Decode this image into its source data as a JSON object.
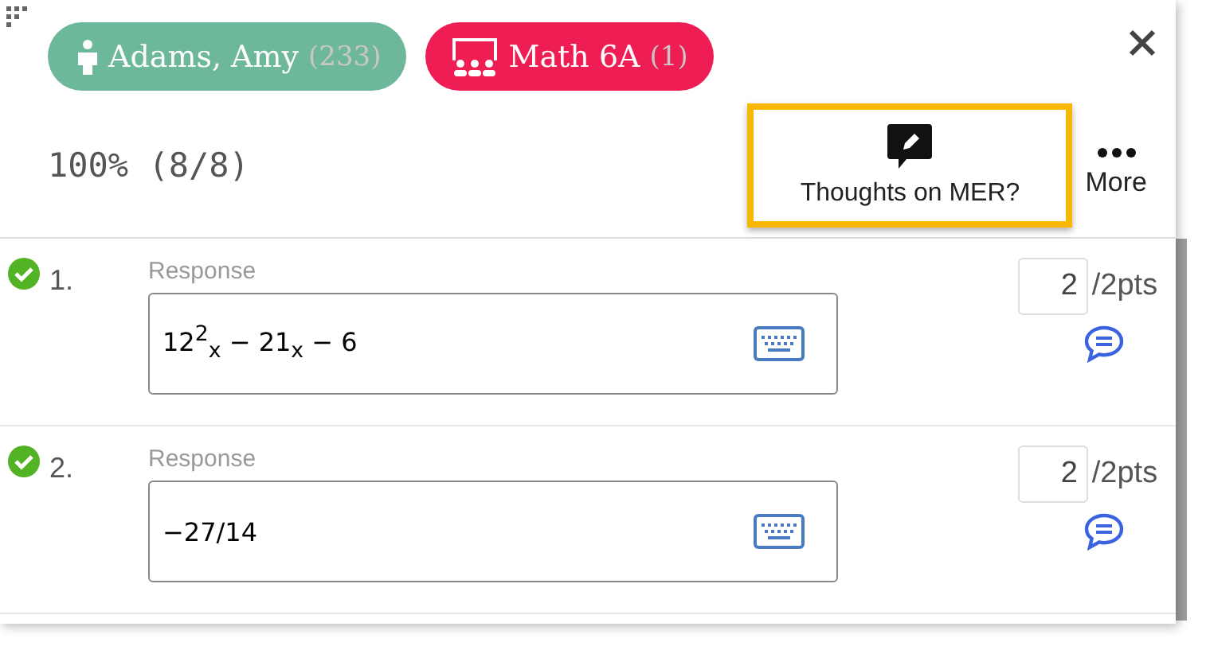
{
  "header": {
    "student": {
      "name": "Adams, Amy",
      "count": "(233)"
    },
    "class": {
      "name": "Math 6A",
      "count": "(1)"
    },
    "score": "100% (8/8)",
    "feedback_button": {
      "label": "Thoughts on MER?",
      "highlighted": true
    },
    "more_button": {
      "label": "More"
    }
  },
  "questions": [
    {
      "number": "1.",
      "correct": true,
      "label": "Response",
      "answer": "12$^{2}$$_{x}$ − 21$_{x}$ − 6",
      "points": "2",
      "max": "/2pts"
    },
    {
      "number": "2.",
      "correct": true,
      "label": "Response",
      "answer": "−27/14",
      "points": "2",
      "max": "/2pts"
    }
  ]
}
